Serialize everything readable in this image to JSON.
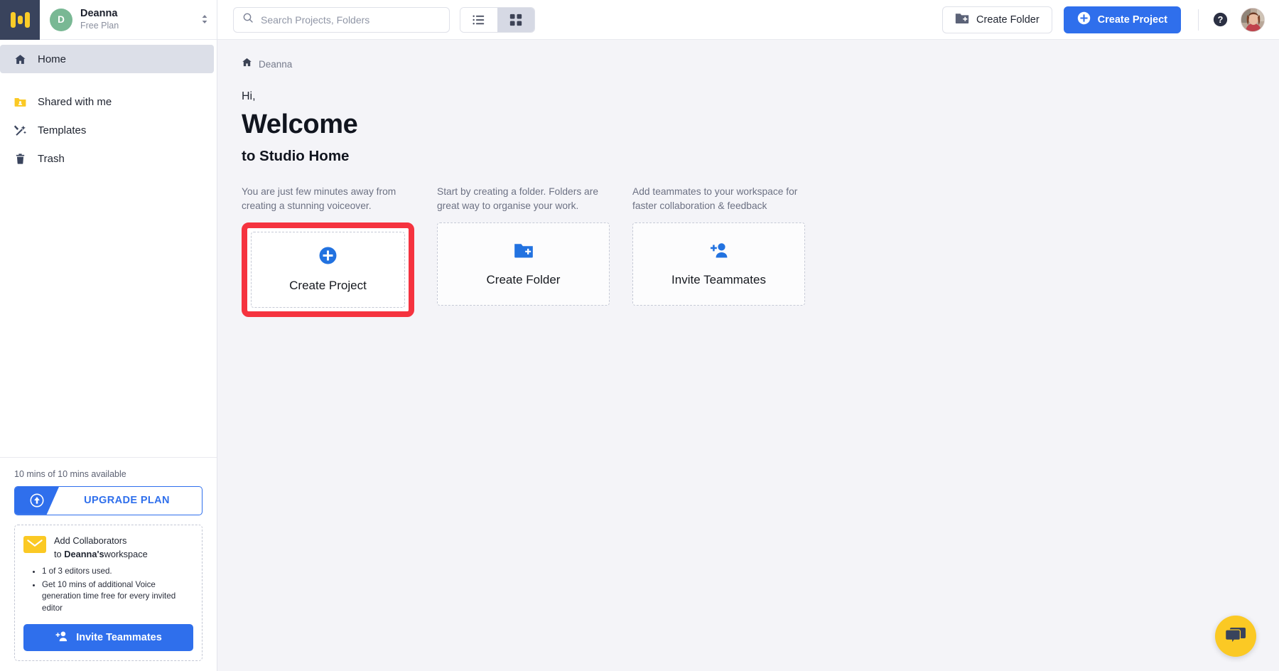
{
  "sidebar": {
    "logo": "brand-logo",
    "workspace": {
      "avatar_initial": "D",
      "name": "Deanna",
      "plan": "Free Plan"
    },
    "nav": [
      {
        "label": "Home",
        "icon": "home-icon",
        "active": true
      },
      {
        "label": "Shared with me",
        "icon": "shared-folder-icon",
        "active": false
      },
      {
        "label": "Templates",
        "icon": "templates-icon",
        "active": false
      },
      {
        "label": "Trash",
        "icon": "trash-icon",
        "active": false
      }
    ],
    "usage_text": "10 mins of 10 mins available",
    "upgrade_label": "UPGRADE PLAN",
    "collaborators": {
      "title": "Add Collaborators",
      "subtitle_prefix": "to ",
      "subtitle_strong": "Deanna's",
      "subtitle_suffix": "workspace",
      "bullets": [
        "1 of 3 editors used.",
        "Get 10 mins of additional Voice generation time free for every invited editor"
      ],
      "invite_label": "Invite Teammates"
    }
  },
  "topbar": {
    "search_placeholder": "Search Projects, Folders",
    "search_value": "",
    "view_list_label": "list-view",
    "view_grid_label": "grid-view",
    "selected_view": "grid",
    "create_folder_label": "Create Folder",
    "create_project_label": "Create Project",
    "help_label": "help-icon",
    "avatar_label": "user-avatar"
  },
  "content": {
    "breadcrumb": "Deanna",
    "greeting": "Hi,",
    "welcome": "Welcome",
    "subtitle": "to Studio Home",
    "cards": [
      {
        "description": "You are just few minutes away from creating a stunning voiceover.",
        "label": "Create Project",
        "icon": "plus-circle-icon",
        "highlighted": true
      },
      {
        "description": "Start by creating a folder. Folders are great way to organise your work.",
        "label": "Create Folder",
        "icon": "folder-plus-icon",
        "highlighted": false
      },
      {
        "description": "Add teammates to your workspace for faster collaboration & feedback",
        "label": "Invite Teammates",
        "icon": "person-add-icon",
        "highlighted": false
      }
    ],
    "chat_label": "chat-support-button"
  },
  "colors": {
    "accent_blue": "#2f6fec",
    "brand_yellow": "#fbc924",
    "logo_navy": "#39435c",
    "highlight_red": "#f5333f",
    "canvas": "#f4f4f8"
  }
}
